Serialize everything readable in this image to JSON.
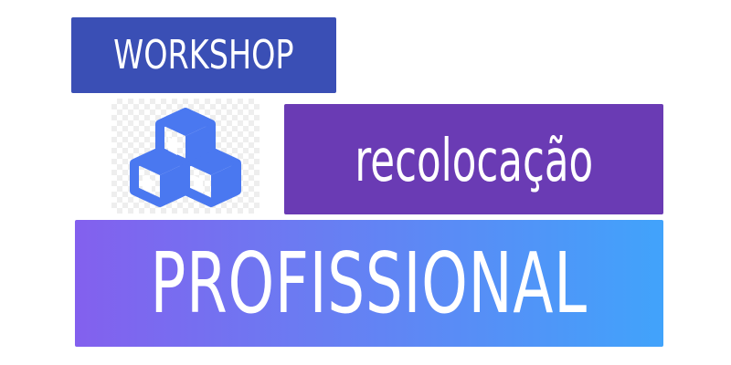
{
  "banners": {
    "workshop": "WORKSHOP",
    "recolocacao": "recolocação",
    "profissional": "PROFISSIONAL"
  },
  "logo": {
    "icon": "cubes-icon",
    "color": "#4a78f0"
  },
  "colors": {
    "workshop_bg": "#3a4fb5",
    "recolocacao_bg": "#6a3bb4",
    "profissional_gradient_start": "#8360ee",
    "profissional_gradient_end": "#41a3fb",
    "text": "#ffffff"
  }
}
